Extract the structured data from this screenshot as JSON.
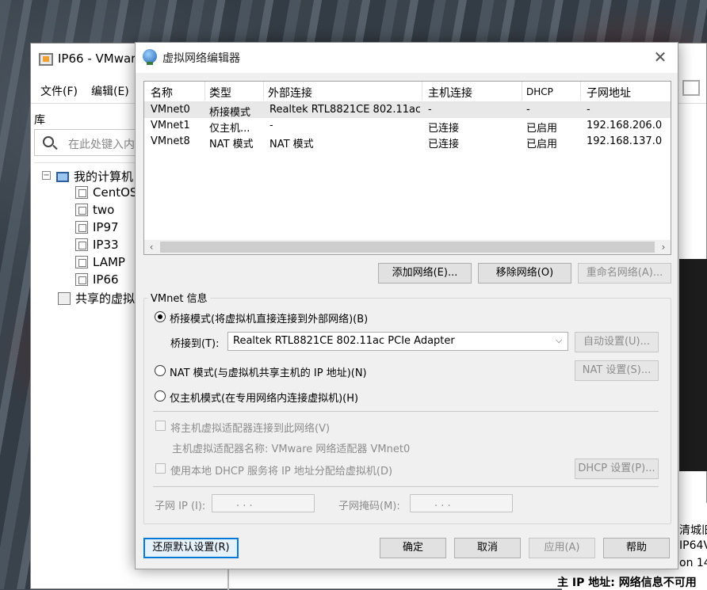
{
  "vmware": {
    "title": "IP66 - VMwar",
    "menu": {
      "file": "文件(F)",
      "edit": "编辑(E)"
    },
    "library_label": "库",
    "search_placeholder": "在此处键入内",
    "tree": {
      "root": "我的计算机",
      "vms": [
        "CentOS",
        "two",
        "IP97",
        "IP33",
        "LAMP",
        "IP66"
      ],
      "shared": "共享的虚拟"
    },
    "right_text": [
      "清城旧",
      "IP64V",
      "on 14",
      "主 IP 地址:  网络信息不可用"
    ]
  },
  "dialog": {
    "title": "虚拟网络编辑器",
    "columns": [
      "名称",
      "类型",
      "外部连接",
      "主机连接",
      "DHCP",
      "子网地址"
    ],
    "rows": [
      {
        "name": "VMnet0",
        "type": "桥接模式",
        "external": "Realtek RTL8821CE 802.11ac ...",
        "host": "-",
        "dhcp": "-",
        "subnet": "-"
      },
      {
        "name": "VMnet1",
        "type": "仅主机...",
        "external": "-",
        "host": "已连接",
        "dhcp": "已启用",
        "subnet": "192.168.206.0"
      },
      {
        "name": "VMnet8",
        "type": "NAT 模式",
        "external": "NAT 模式",
        "host": "已连接",
        "dhcp": "已启用",
        "subnet": "192.168.137.0"
      }
    ],
    "buttons": {
      "add_network": "添加网络(E)...",
      "remove_network": "移除网络(O)",
      "rename_network": "重命名网络(A)...",
      "auto_settings": "自动设置(U)...",
      "nat_settings": "NAT 设置(S)...",
      "dhcp_settings": "DHCP 设置(P)...",
      "restore_defaults": "还原默认设置(R)",
      "ok": "确定",
      "cancel": "取消",
      "apply": "应用(A)",
      "help": "帮助"
    },
    "vmnet_info": {
      "label": "VMnet 信息",
      "bridged": "桥接模式(将虚拟机直接连接到外部网络)(B)",
      "bridge_to_label": "桥接到(T):",
      "bridge_to_value": "Realtek RTL8821CE 802.11ac PCIe Adapter",
      "nat": "NAT 模式(与虚拟机共享主机的 IP 地址)(N)",
      "host_only": "仅主机模式(在专用网络内连接虚拟机)(H)",
      "connect_host_adapter": "将主机虚拟适配器连接到此网络(V)",
      "host_adapter_name": "主机虚拟适配器名称: VMware 网络适配器 VMnet0",
      "use_dhcp": "使用本地 DHCP 服务将 IP 地址分配给虚拟机(D)",
      "subnet_ip_label": "子网 IP (I):",
      "subnet_mask_label": "子网掩码(M):",
      "subnet_ip_value": ".   .   .",
      "subnet_mask_value": ".   .   ."
    }
  },
  "colors": {
    "dialog_bg": "#f0f0f0",
    "focus_blue": "#0078d7",
    "disabled_text": "#8c8c8c"
  }
}
